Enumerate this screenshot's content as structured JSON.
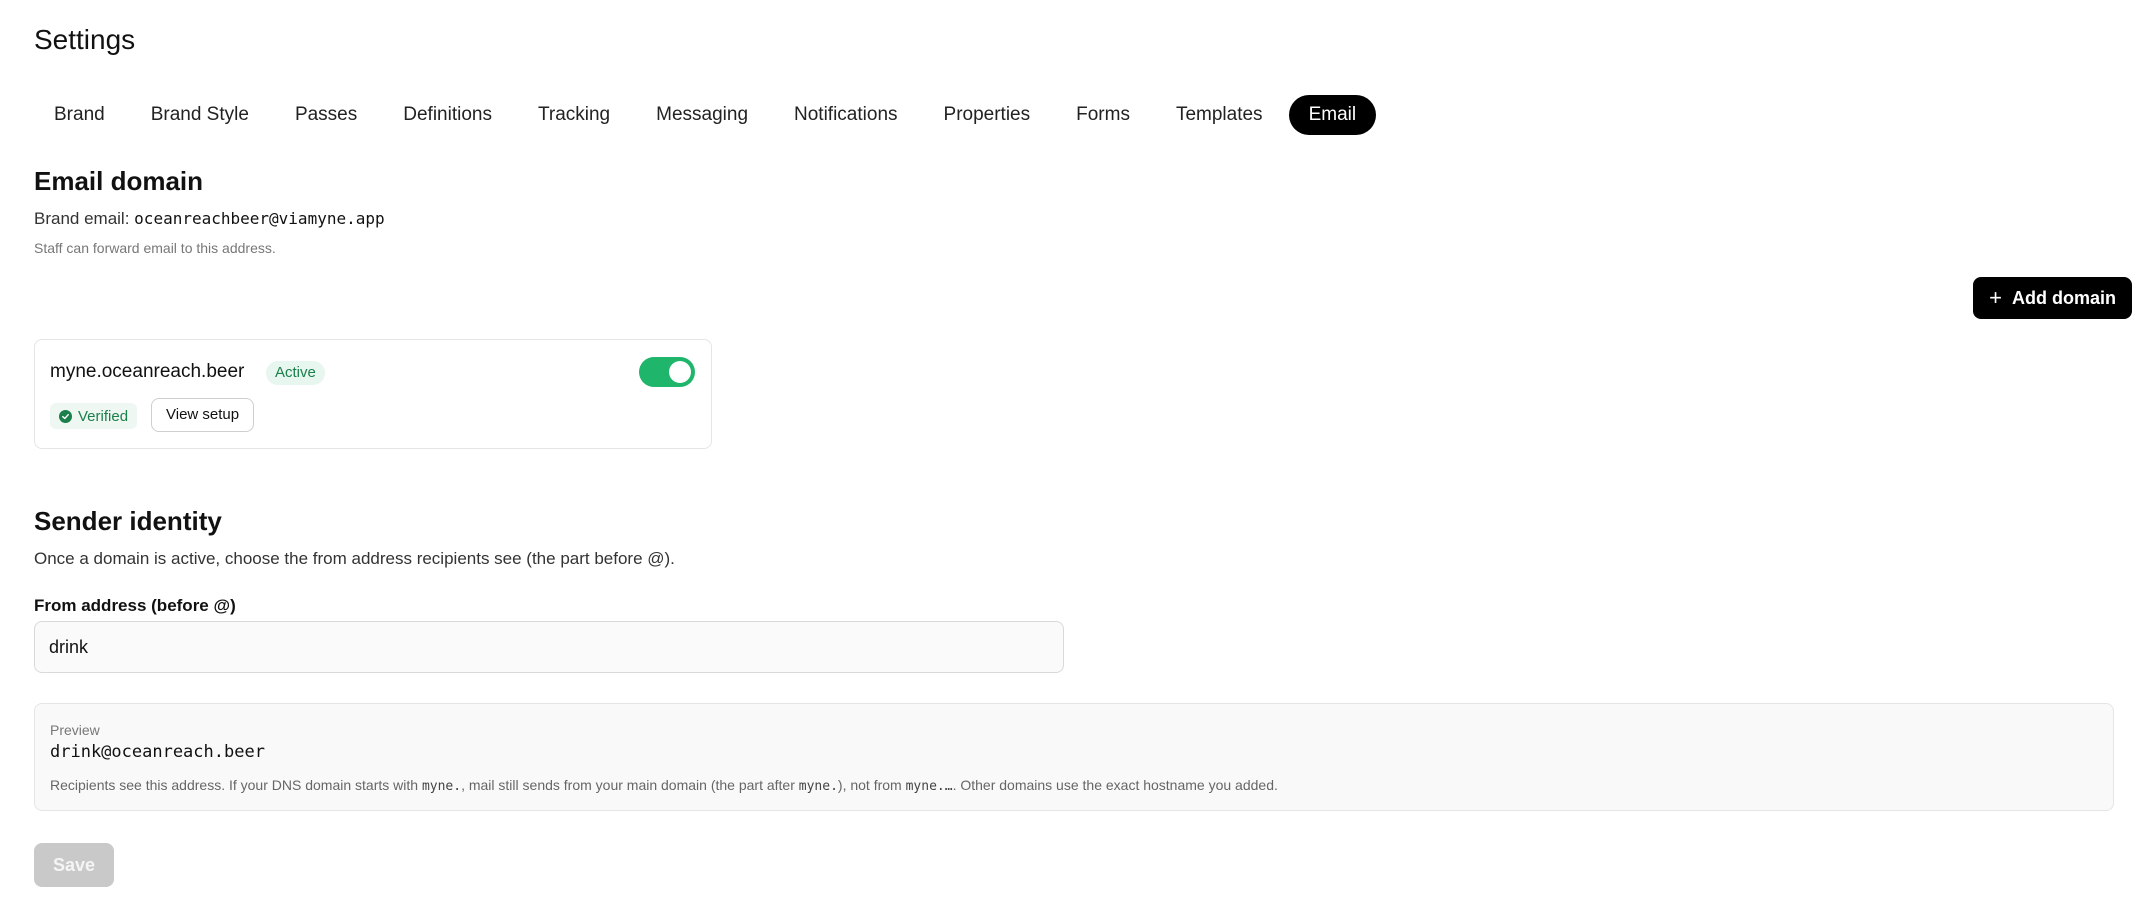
{
  "page_title": "Settings",
  "tabs": [
    {
      "label": "Brand"
    },
    {
      "label": "Brand Style"
    },
    {
      "label": "Passes"
    },
    {
      "label": "Definitions"
    },
    {
      "label": "Tracking"
    },
    {
      "label": "Messaging"
    },
    {
      "label": "Notifications"
    },
    {
      "label": "Properties"
    },
    {
      "label": "Forms"
    },
    {
      "label": "Templates"
    },
    {
      "label": "Email",
      "active": true
    }
  ],
  "email_domain": {
    "heading": "Email domain",
    "brand_email_label": "Brand email:",
    "brand_email_value": "oceanreachbeer@viamyne.app",
    "hint": "Staff can forward email to this address.",
    "add_domain_label": "Add domain",
    "add_domain_icon": "plus-icon"
  },
  "domain_card": {
    "name": "myne.oceanreach.beer",
    "status_badge": "Active",
    "toggle_on": true,
    "verified_label": "Verified",
    "verified_icon": "check-circle-icon",
    "view_setup_label": "View setup"
  },
  "sender_identity": {
    "heading": "Sender identity",
    "description": "Once a domain is active, choose the from address recipients see (the part before @).",
    "field_label": "From address (before @)",
    "field_value": "drink"
  },
  "preview": {
    "label": "Preview",
    "address": "drink@oceanreach.beer",
    "note_part1": "Recipients see this address. If your DNS domain starts with ",
    "note_code1": "myne.",
    "note_part2": ", mail still sends from your main domain (the part after ",
    "note_code2": "myne.",
    "note_part3": "), not from ",
    "note_code3": "myne.…",
    "note_part4": ". Other domains use the exact hostname you added."
  },
  "save_label": "Save",
  "colors": {
    "accent": "#000000",
    "success": "#1fb56b",
    "success_text": "#1a7f4b",
    "disabled": "#c9c9c9"
  }
}
